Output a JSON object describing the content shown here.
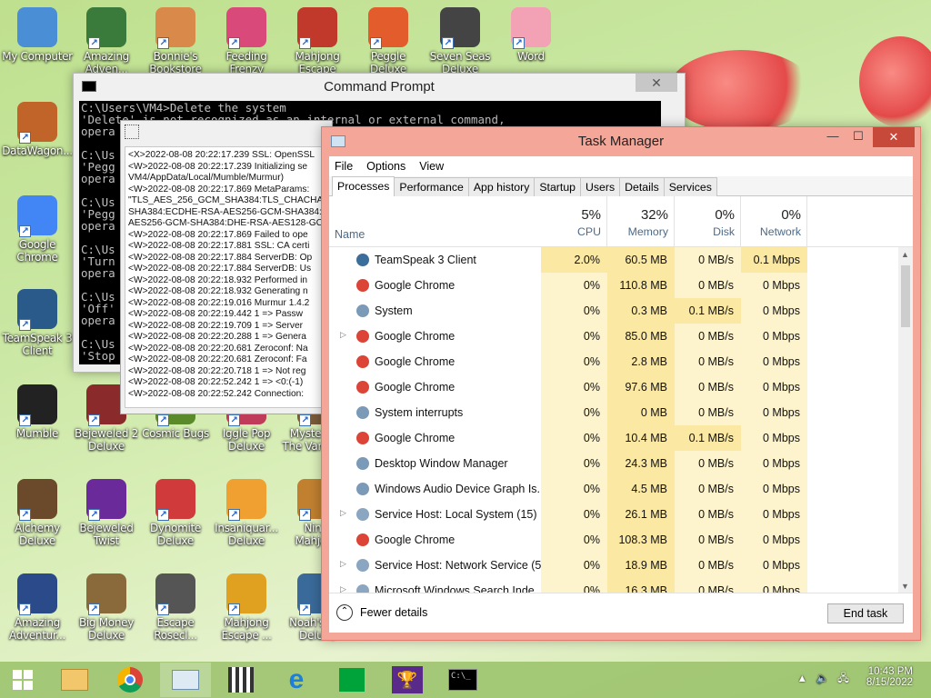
{
  "desktop": {
    "icons": [
      {
        "label": "My Computer",
        "color": "#4a8fd6",
        "glyph": "computer-icon"
      },
      {
        "label": "Amazing Adven...",
        "color": "#3a7a3a",
        "glyph": "compass-icon"
      },
      {
        "label": "Bonnie's Bookstore",
        "color": "#d98a4a",
        "glyph": "woman-icon"
      },
      {
        "label": "Feeding Frenzy Deluxe",
        "color": "#d94a7a",
        "glyph": "fish-icon"
      },
      {
        "label": "Mahjong Escape Ancient",
        "color": "#c0392b",
        "glyph": "gate-icon"
      },
      {
        "label": "Peggle Deluxe",
        "color": "#e35c2c",
        "glyph": "peggle-icon"
      },
      {
        "label": "Seven Seas Deluxe",
        "color": "#444444",
        "glyph": "skull-icon"
      },
      {
        "label": "Word",
        "color": "#f2a2b4",
        "glyph": "flower-icon"
      },
      {
        "label": "DataWagon...",
        "color": "#c0642a",
        "glyph": "sun-icon"
      },
      {
        "label": "Google Chrome",
        "color": "#4285f4",
        "glyph": "chrome-icon"
      },
      {
        "label": "TeamSpeak 3 Client",
        "color": "#2a5a8a",
        "glyph": "teamspeak-icon"
      },
      {
        "label": "Mumble",
        "color": "#222222",
        "glyph": "headset-icon"
      },
      {
        "label": "Bejeweled 2 Deluxe",
        "color": "#8a2a2a",
        "glyph": "gem-icon"
      },
      {
        "label": "Cosmic Bugs",
        "color": "#5a8a2a",
        "glyph": "bug-icon"
      },
      {
        "label": "Iggle Pop Deluxe",
        "color": "#c03a5a",
        "glyph": "iggle-icon"
      },
      {
        "label": "Mystery of The Vanished",
        "color": "#7a5a3a",
        "glyph": "book-icon"
      },
      {
        "label": "Alchemy Deluxe",
        "color": "#6a4a2a",
        "glyph": "wizard-icon"
      },
      {
        "label": "Bejeweled Twist",
        "color": "#6a2a9a",
        "glyph": "gem-icon"
      },
      {
        "label": "Dynomite Deluxe",
        "color": "#d03a3a",
        "glyph": "egg-icon"
      },
      {
        "label": "Insaniquar... Deluxe",
        "color": "#f0a030",
        "glyph": "fish-icon"
      },
      {
        "label": "Ninja Mahjong",
        "color": "#c08030",
        "glyph": "tile-icon"
      },
      {
        "label": "Amazing Adventur...",
        "color": "#2a4a8a",
        "glyph": "gem-icon"
      },
      {
        "label": "Big Money Deluxe",
        "color": "#8a6a3a",
        "glyph": "moneybag-icon"
      },
      {
        "label": "Escape Rosecl...",
        "color": "#555555",
        "glyph": "moon-icon"
      },
      {
        "label": "Mahjong Escape ...",
        "color": "#e0a020",
        "glyph": "tile-icon"
      },
      {
        "label": "Noah's Ark Deluxe",
        "color": "#3a6a9a",
        "glyph": "ark-icon"
      }
    ]
  },
  "cmd": {
    "title": "Command Prompt",
    "lines": [
      "C:\\Users\\VM4>Delete the system",
      "'Delete' is not recognized as an internal or external command,",
      "opera",
      "",
      "C:\\Us",
      "'Pegg",
      "opera",
      "",
      "C:\\Us",
      "'Pegg",
      "opera",
      "",
      "C:\\Us",
      "'Turn",
      "opera",
      "",
      "C:\\Us",
      "'Off'",
      "opera",
      "",
      "C:\\Us",
      "'Stop",
      "opera",
      "",
      "C:\\Us"
    ]
  },
  "log": {
    "lines": [
      "<X>2022-08-08 20:22:17.239 SSL: OpenSSL",
      "<W>2022-08-08 20:22:17.239 Initializing se",
      "VM4/AppData/Local/Mumble/Murmur)",
      "<W>2022-08-08 20:22:17.869 MetaParams:",
      "\"TLS_AES_256_GCM_SHA384:TLS_CHACHA2",
      "SHA384:ECDHE-RSA-AES256-GCM-SHA384:E",
      "AES256-GCM-SHA384:DHE-RSA-AES128-GCM",
      "<W>2022-08-08 20:22:17.869 Failed to ope",
      "<W>2022-08-08 20:22:17.881 SSL: CA certi",
      "<W>2022-08-08 20:22:17.884 ServerDB: Op",
      "<W>2022-08-08 20:22:17.884 ServerDB: Us",
      "<W>2022-08-08 20:22:18.932 Performed in",
      "<W>2022-08-08 20:22:18.932 Generating n",
      "<W>2022-08-08 20:22:19.016 Murmur 1.4.2",
      "<W>2022-08-08 20:22:19.442 1 => Passw",
      "<W>2022-08-08 20:22:19.709 1 => Server",
      "<W>2022-08-08 20:22:20.288 1 => Genera",
      "<W>2022-08-08 20:22:20.681 Zeroconf: Na",
      "<W>2022-08-08 20:22:20.681 Zeroconf: Fa",
      "<W>2022-08-08 20:22:20.718 1 => Not reg",
      "<W>2022-08-08 20:22:52.242 1 => <0:(-1)",
      "<W>2022-08-08 20:22:52.242 Connection:"
    ]
  },
  "taskmanager": {
    "title": "Task Manager",
    "menu": [
      "File",
      "Options",
      "View"
    ],
    "tabs": [
      "Processes",
      "Performance",
      "App history",
      "Startup",
      "Users",
      "Details",
      "Services"
    ],
    "active_tab": 0,
    "name_header": "Name",
    "columns": [
      {
        "pct": "5%",
        "name": "CPU"
      },
      {
        "pct": "32%",
        "name": "Memory"
      },
      {
        "pct": "0%",
        "name": "Disk"
      },
      {
        "pct": "0%",
        "name": "Network"
      }
    ],
    "rows": [
      {
        "name": "TeamSpeak 3 Client",
        "cpu": "2.0%",
        "mem": "60.5 MB",
        "disk": "0 MB/s",
        "net": "0.1 Mbps",
        "icon": "#3b6e9a",
        "expand": false
      },
      {
        "name": "Google Chrome",
        "cpu": "0%",
        "mem": "110.8 MB",
        "disk": "0 MB/s",
        "net": "0 Mbps",
        "icon": "#db4437",
        "expand": false
      },
      {
        "name": "System",
        "cpu": "0%",
        "mem": "0.3 MB",
        "disk": "0.1 MB/s",
        "net": "0 Mbps",
        "icon": "#7a9ab8",
        "expand": false
      },
      {
        "name": "Google Chrome",
        "cpu": "0%",
        "mem": "85.0 MB",
        "disk": "0 MB/s",
        "net": "0 Mbps",
        "icon": "#db4437",
        "expand": true
      },
      {
        "name": "Google Chrome",
        "cpu": "0%",
        "mem": "2.8 MB",
        "disk": "0 MB/s",
        "net": "0 Mbps",
        "icon": "#db4437",
        "expand": false
      },
      {
        "name": "Google Chrome",
        "cpu": "0%",
        "mem": "97.6 MB",
        "disk": "0 MB/s",
        "net": "0 Mbps",
        "icon": "#db4437",
        "expand": false
      },
      {
        "name": "System interrupts",
        "cpu": "0%",
        "mem": "0 MB",
        "disk": "0 MB/s",
        "net": "0 Mbps",
        "icon": "#7a9ab8",
        "expand": false
      },
      {
        "name": "Google Chrome",
        "cpu": "0%",
        "mem": "10.4 MB",
        "disk": "0.1 MB/s",
        "net": "0 Mbps",
        "icon": "#db4437",
        "expand": false
      },
      {
        "name": "Desktop Window Manager",
        "cpu": "0%",
        "mem": "24.3 MB",
        "disk": "0 MB/s",
        "net": "0 Mbps",
        "icon": "#7a9ab8",
        "expand": false
      },
      {
        "name": "Windows Audio Device Graph Is...",
        "cpu": "0%",
        "mem": "4.5 MB",
        "disk": "0 MB/s",
        "net": "0 Mbps",
        "icon": "#7a9ab8",
        "expand": false
      },
      {
        "name": "Service Host: Local System (15)",
        "cpu": "0%",
        "mem": "26.1 MB",
        "disk": "0 MB/s",
        "net": "0 Mbps",
        "icon": "#8aa6c0",
        "expand": true
      },
      {
        "name": "Google Chrome",
        "cpu": "0%",
        "mem": "108.3 MB",
        "disk": "0 MB/s",
        "net": "0 Mbps",
        "icon": "#db4437",
        "expand": false
      },
      {
        "name": "Service Host: Network Service (5)",
        "cpu": "0%",
        "mem": "18.9 MB",
        "disk": "0 MB/s",
        "net": "0 Mbps",
        "icon": "#8aa6c0",
        "expand": true
      },
      {
        "name": "Microsoft Windows Search Inde...",
        "cpu": "0%",
        "mem": "16.3 MB",
        "disk": "0 MB/s",
        "net": "0 Mbps",
        "icon": "#8aa6c0",
        "expand": true
      }
    ],
    "fewer_details": "Fewer details",
    "end_task": "End task"
  },
  "taskbar": {
    "time": "10:43 PM",
    "date": "8/15/2022",
    "items": [
      "start-button",
      "file-explorer-icon",
      "chrome-icon",
      "task-manager-icon",
      "pixel-game-icon",
      "internet-explorer-icon",
      "store-icon",
      "trophy-icon",
      "cmd-icon"
    ]
  }
}
